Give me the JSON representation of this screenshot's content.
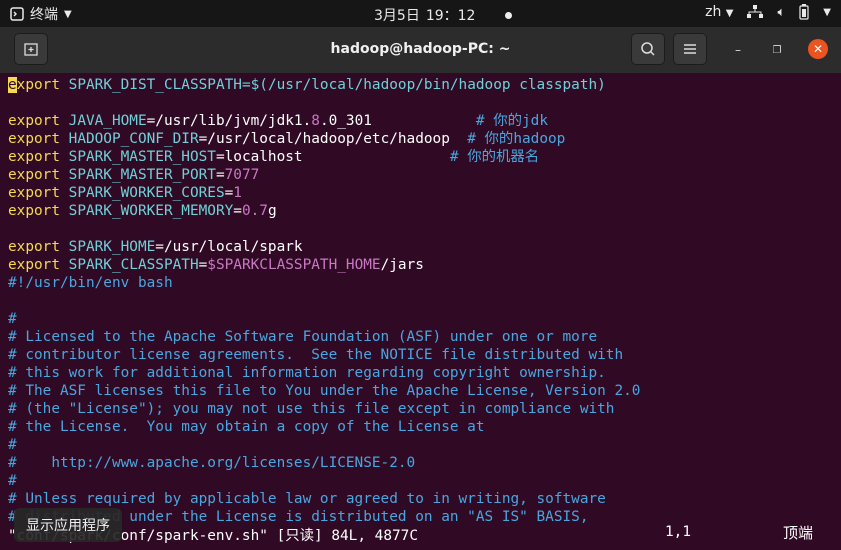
{
  "topbar": {
    "app_name": "终端",
    "date": "3月5日",
    "time": "19：12",
    "input_method": "zh"
  },
  "window": {
    "title": "hadoop@hadoop-PC: ~"
  },
  "editor": {
    "lines": [
      [
        {
          "t": "e",
          "c": "cursor"
        },
        {
          "t": "xport",
          "c": "kw"
        },
        {
          "t": " "
        },
        {
          "t": "SPARK_DIST_CLASSPATH",
          "c": "var"
        },
        {
          "t": "=$(/usr/local/hadoop/bin/hadoop classpath)",
          "c": "var"
        }
      ],
      [],
      [
        {
          "t": "export",
          "c": "kw"
        },
        {
          "t": " "
        },
        {
          "t": "JAVA_HOME",
          "c": "var"
        },
        {
          "t": "=/usr/lib/jvm/jdk1."
        },
        {
          "t": "8",
          "c": "num"
        },
        {
          "t": ".0_301            "
        },
        {
          "t": "# 你的jdk",
          "c": "cm"
        }
      ],
      [
        {
          "t": "export",
          "c": "kw"
        },
        {
          "t": " "
        },
        {
          "t": "HADOOP_CONF_DIR",
          "c": "var"
        },
        {
          "t": "=/usr/local/hadoop/etc/hadoop  "
        },
        {
          "t": "# 你的hadoop",
          "c": "cm"
        }
      ],
      [
        {
          "t": "export",
          "c": "kw"
        },
        {
          "t": " "
        },
        {
          "t": "SPARK_MASTER_HOST",
          "c": "var"
        },
        {
          "t": "=localhost                 "
        },
        {
          "t": "# 你的机器名",
          "c": "cm"
        }
      ],
      [
        {
          "t": "export",
          "c": "kw"
        },
        {
          "t": " "
        },
        {
          "t": "SPARK_MASTER_PORT",
          "c": "var"
        },
        {
          "t": "="
        },
        {
          "t": "7077",
          "c": "num"
        }
      ],
      [
        {
          "t": "export",
          "c": "kw"
        },
        {
          "t": " "
        },
        {
          "t": "SPARK_WORKER_CORES",
          "c": "var"
        },
        {
          "t": "="
        },
        {
          "t": "1",
          "c": "num"
        }
      ],
      [
        {
          "t": "export",
          "c": "kw"
        },
        {
          "t": " "
        },
        {
          "t": "SPARK_WORKER_MEMORY",
          "c": "var"
        },
        {
          "t": "="
        },
        {
          "t": "0.7",
          "c": "num"
        },
        {
          "t": "g"
        }
      ],
      [],
      [
        {
          "t": "export",
          "c": "kw"
        },
        {
          "t": " "
        },
        {
          "t": "SPARK_HOME",
          "c": "var"
        },
        {
          "t": "=/usr/local/spark"
        }
      ],
      [
        {
          "t": "export",
          "c": "kw"
        },
        {
          "t": " "
        },
        {
          "t": "SPARK_CLASSPATH",
          "c": "var"
        },
        {
          "t": "="
        },
        {
          "t": "$SPARKCLASSPATH_HOME",
          "c": "num"
        },
        {
          "t": "/jars"
        }
      ],
      [
        {
          "t": "#!/usr/bin/env bash",
          "c": "cm"
        }
      ],
      [],
      [
        {
          "t": "#",
          "c": "cm"
        }
      ],
      [
        {
          "t": "# Licensed to the Apache Software Foundation (ASF) under one or more",
          "c": "cm"
        }
      ],
      [
        {
          "t": "# contributor license agreements.  See the NOTICE file distributed with",
          "c": "cm"
        }
      ],
      [
        {
          "t": "# this work for additional information regarding copyright ownership.",
          "c": "cm"
        }
      ],
      [
        {
          "t": "# The ASF licenses this file to You under the Apache License, Version 2.0",
          "c": "cm"
        }
      ],
      [
        {
          "t": "# (the \"License\"); you may not use this file except in compliance with",
          "c": "cm"
        }
      ],
      [
        {
          "t": "# the License.  You may obtain a copy of the License at",
          "c": "cm"
        }
      ],
      [
        {
          "t": "#",
          "c": "cm"
        }
      ],
      [
        {
          "t": "#    http://www.apache.org/licenses/LICENSE-2.0",
          "c": "cm"
        }
      ],
      [
        {
          "t": "#",
          "c": "cm"
        }
      ],
      [
        {
          "t": "# Unless required by applicable law or agreed to in writing, software",
          "c": "cm"
        }
      ],
      [
        {
          "t": "# distributed under the License is distributed on an \"AS IS\" BASIS,",
          "c": "cm"
        }
      ]
    ],
    "status_text": "\"conf/spark/conf/spark-env.sh\" [只读] 84L, 4877C",
    "cursor_pos": "1,1",
    "scroll_pos": "顶端"
  },
  "tooltip": "显示应用程序",
  "colors": {
    "background": "#300a24",
    "keyword": "#f5d94f",
    "variable": "#6fd0d8",
    "number": "#c978c3",
    "comment": "#49a6e0"
  }
}
